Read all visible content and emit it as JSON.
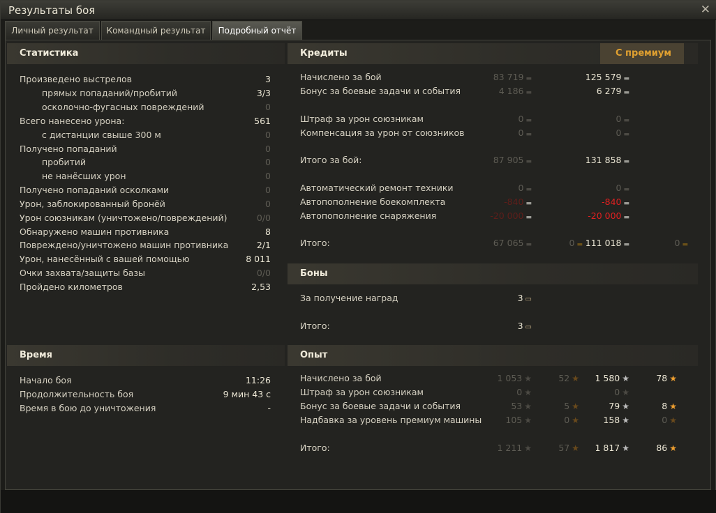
{
  "window": {
    "title": "Результаты боя",
    "close_icon": "close-icon"
  },
  "tabs": [
    {
      "label": "Личный результат",
      "active": false
    },
    {
      "label": "Командный результат",
      "active": false
    },
    {
      "label": "Подробный отчёт",
      "active": true
    }
  ],
  "stats": {
    "header": "Статистика",
    "rows": [
      {
        "label": "Произведено выстрелов",
        "value": "3"
      },
      {
        "label": "прямых попаданий/пробитий",
        "value": "3/3"
      },
      {
        "label": "осколочно-фугасных повреждений",
        "value": "0"
      },
      {
        "label": "Всего нанесено урона:",
        "value": "561"
      },
      {
        "label": "с дистанции свыше 300 м",
        "value": "0"
      },
      {
        "label": "Получено попаданий",
        "value": "0"
      },
      {
        "label": "пробитий",
        "value": "0"
      },
      {
        "label": "не нанёсших урон",
        "value": "0"
      },
      {
        "label": "Получено попаданий осколками",
        "value": "0"
      },
      {
        "label": "Урон, заблокированный бронёй",
        "value": "0"
      },
      {
        "label": "Урон союзникам (уничтожено/повреждений)",
        "value": "0/0"
      },
      {
        "label": "Обнаружено машин противника",
        "value": "8"
      },
      {
        "label": "Повреждено/уничтожено машин противника",
        "value": "2/1"
      },
      {
        "label": "Урон, нанесённый с вашей помощью",
        "value": "8 011"
      },
      {
        "label": "Очки захвата/защиты базы",
        "value": "0/0"
      },
      {
        "label": "Пройдено километров",
        "value": "2,53"
      }
    ]
  },
  "time": {
    "header": "Время",
    "rows": [
      {
        "label": "Начало боя",
        "value": "11:26"
      },
      {
        "label": "Продолжительность боя",
        "value": "9 мин 43 с"
      },
      {
        "label": "Время в бою до уничтожения",
        "value": "-"
      }
    ]
  },
  "credits": {
    "header": "Кредиты",
    "premium_label": "С премиум",
    "rows": [
      {
        "label": "Начислено за бой",
        "base": "83 719",
        "prem": "125 579"
      },
      {
        "label": "Бонус за боевые задачи и события",
        "base": "4 186",
        "prem": "6 279"
      },
      {
        "label": "Штраф за урон союзникам",
        "base": "0",
        "prem": "0"
      },
      {
        "label": "Компенсация за урон от союзников",
        "base": "0",
        "prem": "0"
      },
      {
        "label": "Итого за бой:",
        "base": "87 905",
        "prem": "131 858"
      },
      {
        "label": "Автоматический ремонт техники",
        "base": "0",
        "prem": "0"
      },
      {
        "label": "Автопополнение боекомплекта",
        "base": "-840",
        "prem": "-840"
      },
      {
        "label": "Автопополнение снаряжения",
        "base": "-20 000",
        "prem": "-20 000"
      },
      {
        "label": "Итого:",
        "base": "67 065",
        "base_gold": "0",
        "prem": "111 018",
        "prem_gold": "0"
      }
    ],
    "icons": {
      "credit": "credit-icon",
      "gold": "gold-icon"
    }
  },
  "bonds": {
    "header": "Боны",
    "rows": [
      {
        "label": "За получение наград",
        "value": "3"
      },
      {
        "label": "Итого:",
        "value": "3"
      }
    ],
    "icon": "bond-icon"
  },
  "xp": {
    "header": "Опыт",
    "rows": [
      {
        "label": "Начислено за бой",
        "base": "1 053",
        "base_free": "52",
        "prem": "1 580",
        "prem_free": "78"
      },
      {
        "label": "Штраф за урон союзникам",
        "base": "0",
        "base_free": "",
        "prem": "0",
        "prem_free": ""
      },
      {
        "label": "Бонус за боевые задачи и события",
        "base": "53",
        "base_free": "5",
        "prem": "79",
        "prem_free": "8"
      },
      {
        "label": "Надбавка за уровень премиум машины",
        "base": "105",
        "base_free": "0",
        "prem": "158",
        "prem_free": "0"
      },
      {
        "label": "Итого:",
        "base": "1 211",
        "base_free": "57",
        "prem": "1 817",
        "prem_free": "86"
      }
    ],
    "icons": {
      "xp": "xp-star-icon",
      "free_xp": "free-xp-star-icon"
    }
  },
  "colors": {
    "premium": "#e0a030",
    "negative": "#e02020"
  }
}
